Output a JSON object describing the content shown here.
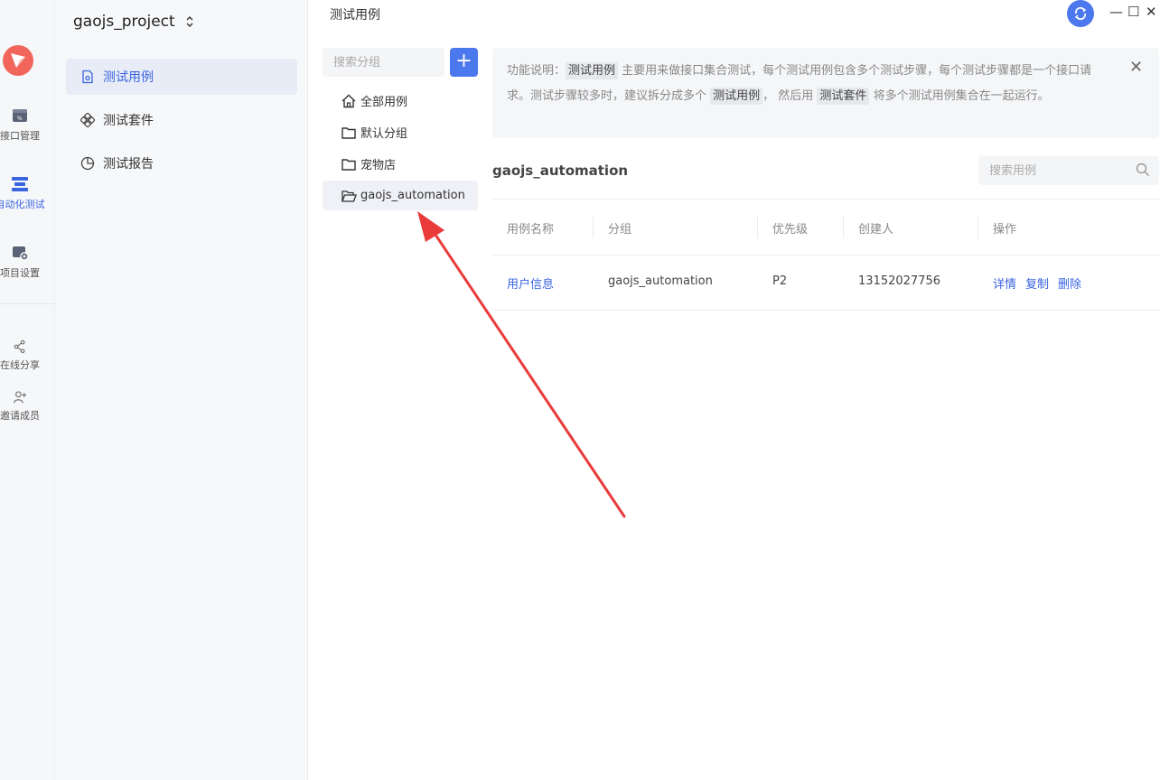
{
  "rail": {
    "items": [
      {
        "label": "接口管理",
        "icon": "api-box-icon"
      },
      {
        "label": "自动化测试",
        "icon": "automation-icon"
      },
      {
        "label": "项目设置",
        "icon": "settings-box-icon"
      },
      {
        "label": "在线分享",
        "icon": "share-icon"
      },
      {
        "label": "邀请成员",
        "icon": "invite-user-icon"
      }
    ],
    "accent": "#3a63e0"
  },
  "sidebar": {
    "project": "gaojs_project",
    "project_chevron": "⌃⌄",
    "items": [
      {
        "label": "测试用例",
        "icon": "file-icon"
      },
      {
        "label": "测试套件",
        "icon": "suite-icon"
      },
      {
        "label": "测试报告",
        "icon": "pie-chart-icon"
      }
    ]
  },
  "titlebar": {
    "title": "测试用例",
    "minimize": "—",
    "maximize": "☐",
    "close": "✕"
  },
  "groups": {
    "search_placeholder": "搜索分组",
    "add_label": "+",
    "items": [
      {
        "label": "全部用例",
        "icon": "home-icon"
      },
      {
        "label": "默认分组",
        "icon": "folder-icon"
      },
      {
        "label": "宠物店",
        "icon": "folder-icon"
      },
      {
        "label": "gaojs_automation",
        "icon": "folder-open-icon"
      }
    ]
  },
  "info": {
    "prefix": "功能说明：",
    "tag1": "测试用例",
    "text1": " 主要用来做接口集合测试，每个测试用例包含多个测试步骤，每个测试步骤都是一个接口请求。测试步骤较多时，建议拆分成多个 ",
    "tag2": "测试用例",
    "text2": "， 然后用 ",
    "tag3": "测试套件",
    "text3": " 将多个测试用例集合在一起运行。",
    "close": "✕"
  },
  "main": {
    "title": "gaojs_automation",
    "search_placeholder": "搜索用例",
    "columns": [
      "用例名称",
      "分组",
      "优先级",
      "创建人",
      "操作"
    ],
    "rows": [
      {
        "name": "用户信息",
        "group": "gaojs_automation",
        "priority": "P2",
        "creator": "13152027756",
        "actions": [
          "详情",
          "复制",
          "删除"
        ]
      }
    ]
  },
  "colors": {
    "primary": "#4c78ee",
    "link": "#3a63e0",
    "annotation": "#ea3b3b"
  }
}
